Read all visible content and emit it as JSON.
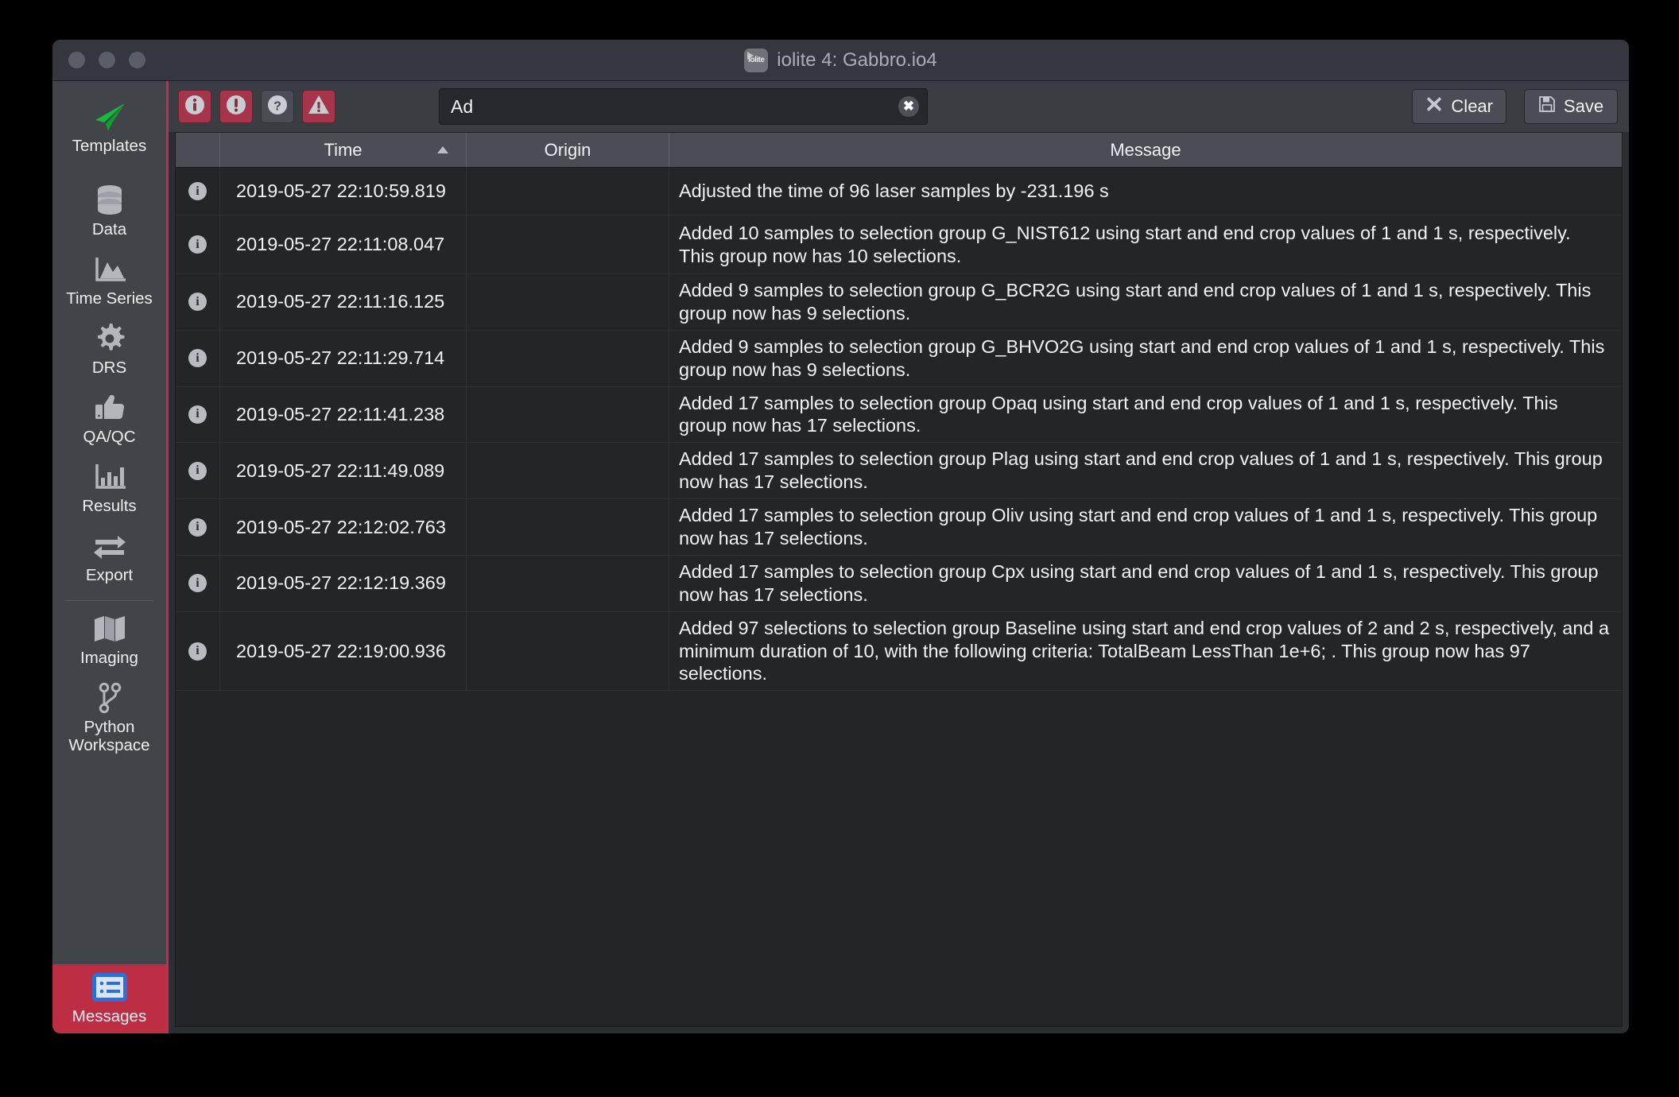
{
  "window": {
    "title": "iolite 4: Gabbro.io4",
    "logo_text": "iolite",
    "traffic_lights": [
      "close-button",
      "minimize-button",
      "zoom-button"
    ]
  },
  "sidebar": {
    "items": [
      {
        "id": "templates",
        "label": "Templates",
        "icon": "paper-plane-icon",
        "selected": false
      },
      {
        "id": "data",
        "label": "Data",
        "icon": "database-icon",
        "selected": false
      },
      {
        "id": "time-series",
        "label": "Time Series",
        "icon": "area-chart-icon",
        "selected": false
      },
      {
        "id": "drs",
        "label": "DRS",
        "icon": "gear-icon",
        "selected": false
      },
      {
        "id": "qa-qc",
        "label": "QA/QC",
        "icon": "thumbs-up-icon",
        "selected": false
      },
      {
        "id": "results",
        "label": "Results",
        "icon": "bar-chart-icon",
        "selected": false
      },
      {
        "id": "export",
        "label": "Export",
        "icon": "exchange-arrows-icon",
        "selected": false
      },
      {
        "id": "imaging",
        "label": "Imaging",
        "icon": "map-icon",
        "selected": false
      },
      {
        "id": "python-workspace",
        "label": "Python Workspace",
        "icon": "code-branch-icon",
        "selected": false
      },
      {
        "id": "messages",
        "label": "Messages",
        "icon": "message-list-icon",
        "selected": true
      }
    ],
    "selected_color": "#bd2e45",
    "accent_border_color": "#c03049"
  },
  "toolbar": {
    "filters": [
      {
        "id": "info-filter",
        "icon": "info-circle-icon",
        "active": true,
        "tooltip": "Information"
      },
      {
        "id": "error-filter",
        "icon": "exclamation-circle-icon",
        "active": true,
        "tooltip": "Errors"
      },
      {
        "id": "debug-filter",
        "icon": "question-circle-icon",
        "active": false,
        "tooltip": "Debug"
      },
      {
        "id": "warning-filter",
        "icon": "warning-triangle-icon",
        "active": true,
        "tooltip": "Warnings"
      }
    ],
    "search": {
      "value": "Ad",
      "placeholder": "",
      "clear_icon": "clear-circle-icon"
    },
    "clear_button": {
      "label": "Clear",
      "icon": "cross-icon"
    },
    "save_button": {
      "label": "Save",
      "icon": "floppy-disk-icon"
    },
    "active_filter_color": "#a6344a",
    "inactive_filter_color": "#4a4d53"
  },
  "table": {
    "columns": [
      {
        "key": "icon",
        "label": ""
      },
      {
        "key": "time",
        "label": "Time",
        "sorted": "ascending"
      },
      {
        "key": "origin",
        "label": "Origin",
        "sorted": ""
      },
      {
        "key": "message",
        "label": "Message",
        "sorted": ""
      }
    ],
    "rows": [
      {
        "icon": "info-icon",
        "time": "2019-05-27 22:10:59.819",
        "origin": "",
        "message": "Adjusted the time of 96 laser samples by -231.196 s"
      },
      {
        "icon": "info-icon",
        "time": "2019-05-27 22:11:08.047",
        "origin": "",
        "message": "Added 10 samples to selection group G_NIST612 using start and end crop values of 1 and 1 s, respectively. This group now has 10 selections."
      },
      {
        "icon": "info-icon",
        "time": "2019-05-27 22:11:16.125",
        "origin": "",
        "message": "Added 9 samples to selection group G_BCR2G using start and end crop values of 1 and 1 s, respectively. This group now has 9 selections."
      },
      {
        "icon": "info-icon",
        "time": "2019-05-27 22:11:29.714",
        "origin": "",
        "message": "Added 9 samples to selection group G_BHVO2G using start and end crop values of 1 and 1 s, respectively. This group now has 9 selections."
      },
      {
        "icon": "info-icon",
        "time": "2019-05-27 22:11:41.238",
        "origin": "",
        "message": "Added 17 samples to selection group Opaq using start and end crop values of 1 and 1 s, respectively. This group now has 17 selections."
      },
      {
        "icon": "info-icon",
        "time": "2019-05-27 22:11:49.089",
        "origin": "",
        "message": "Added 17 samples to selection group Plag using start and end crop values of 1 and 1 s, respectively. This group now has 17 selections."
      },
      {
        "icon": "info-icon",
        "time": "2019-05-27 22:12:02.763",
        "origin": "",
        "message": "Added 17 samples to selection group Oliv using start and end crop values of 1 and 1 s, respectively. This group now has 17 selections."
      },
      {
        "icon": "info-icon",
        "time": "2019-05-27 22:12:19.369",
        "origin": "",
        "message": "Added 17 samples to selection group Cpx using start and end crop values of 1 and 1 s, respectively. This group now has 17 selections."
      },
      {
        "icon": "info-icon",
        "time": "2019-05-27 22:19:00.936",
        "origin": "",
        "message": "Added 97 selections to selection group Baseline using start and end crop values of 2 and 2 s, respectively, and a minimum duration of 10, with the following criteria: TotalBeam LessThan 1e+6; . This group now has 97 selections."
      }
    ]
  }
}
